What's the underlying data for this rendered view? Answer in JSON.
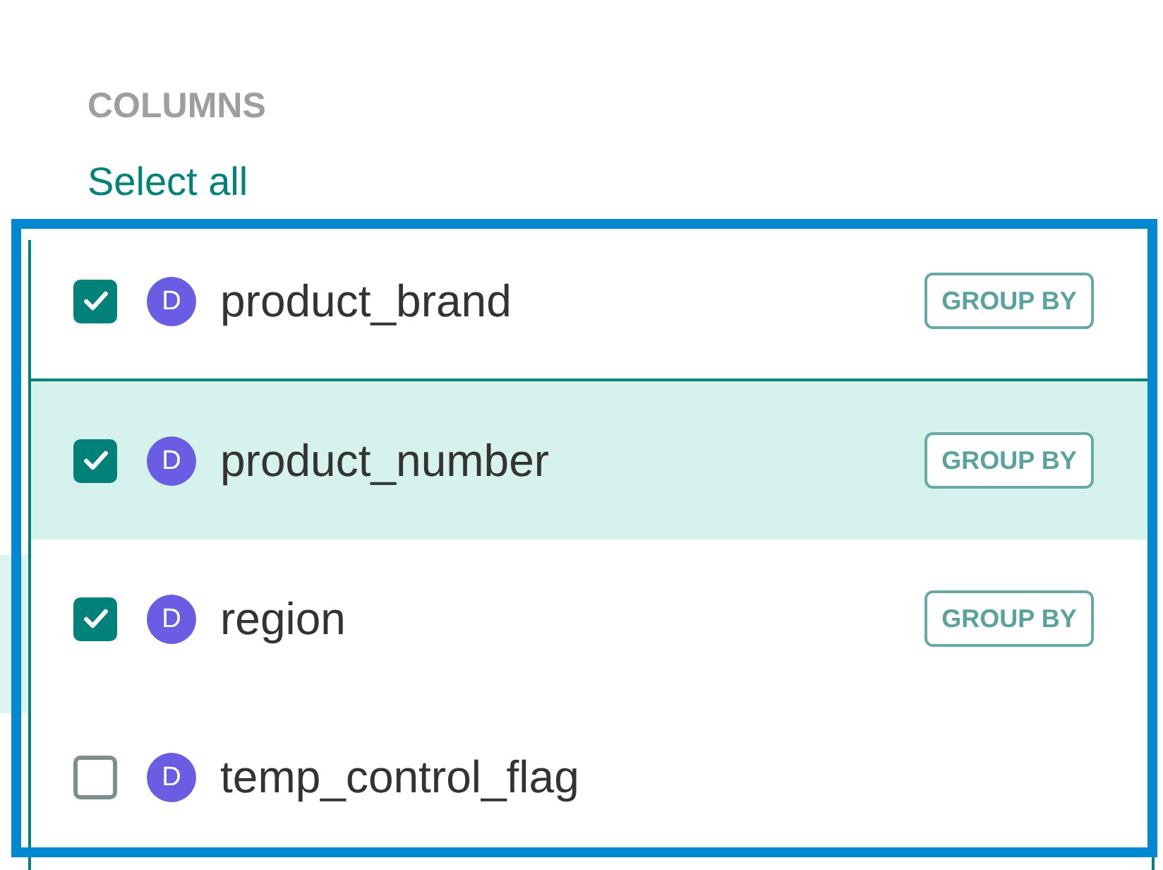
{
  "section": {
    "title": "COLUMNS",
    "select_all": "Select all"
  },
  "columns": [
    {
      "name": "product_brand",
      "type_letter": "D",
      "checked": true,
      "selected": false,
      "action": "GROUP BY"
    },
    {
      "name": "product_number",
      "type_letter": "D",
      "checked": true,
      "selected": true,
      "action": "GROUP BY"
    },
    {
      "name": "region",
      "type_letter": "D",
      "checked": true,
      "selected": false,
      "action": "GROUP BY"
    },
    {
      "name": "temp_control_flag",
      "type_letter": "D",
      "checked": false,
      "selected": false
    }
  ]
}
